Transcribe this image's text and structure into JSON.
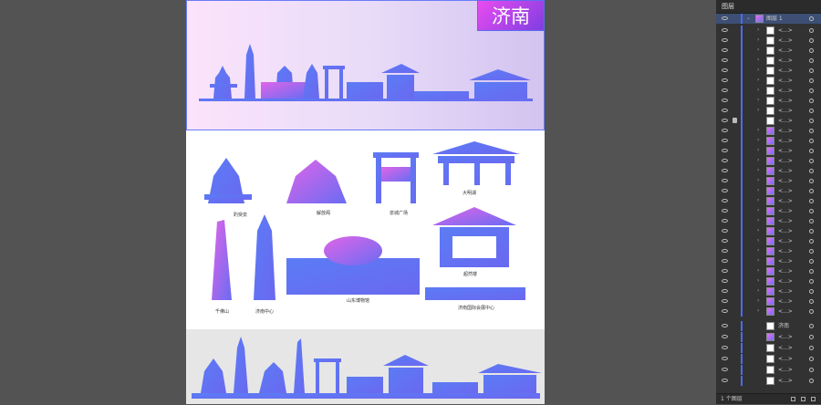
{
  "artboard": {
    "title": "济南"
  },
  "captions": {
    "c1": "趵突泉",
    "c2": "解放阁",
    "c3": "泉城广场",
    "c4": "大明湖",
    "c5": "千佛山",
    "c6": "济南中心",
    "c7": "山东博物馆",
    "c8": "超然楼",
    "c9": "济南国际会展中心"
  },
  "layers_panel": {
    "tab": "图层",
    "top_layer": "图层 1",
    "sublayer_label": "<...>",
    "text_layer": "济南",
    "footer_count": "1 个图层",
    "colors": {
      "accent": "#4a6cf2",
      "selected": "#3d4f74"
    }
  }
}
